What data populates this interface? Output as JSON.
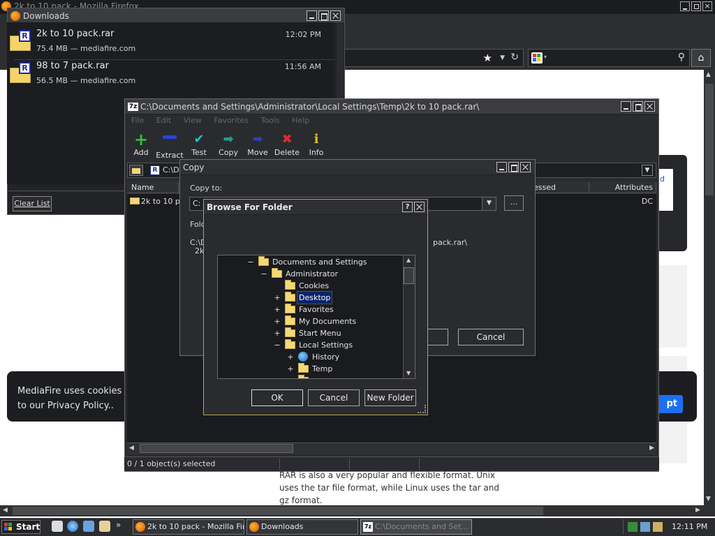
{
  "firefox": {
    "title": "2k to 10 pack - Mozilla Firefox",
    "home_icon": "home-icon"
  },
  "page": {
    "cookie_text": "MediaFire uses cookies to",
    "cookie_text2": "to our Privacy Policy..",
    "cookie_button": "pt",
    "body_text": "RAR is also a very popular and flexible format. Unix uses the tar file format, while Linux uses the tar and gz format.",
    "link_fragment": "d"
  },
  "downloads": {
    "title": "Downloads",
    "items": [
      {
        "name": "2k to 10 pack.rar",
        "meta": "75.4 MB — mediafire.com",
        "time": "12:02 PM"
      },
      {
        "name": "98 to 7 pack.rar",
        "meta": "56.5 MB — mediafire.com",
        "time": "11:56 AM"
      }
    ],
    "clear_label": "Clear List"
  },
  "sevenzip": {
    "title": "C:\\Documents and Settings\\Administrator\\Local Settings\\Temp\\2k to 10 pack.rar\\",
    "app_badge": "7z",
    "menu": [
      "File",
      "Edit",
      "View",
      "Favorites",
      "Tools",
      "Help"
    ],
    "toolbar": [
      {
        "label": "Add",
        "icon": "add-icon",
        "color": "#2fc23a"
      },
      {
        "label": "Extract",
        "icon": "extract-icon",
        "color": "#2545d6"
      },
      {
        "label": "Test",
        "icon": "test-icon",
        "color": "#21c0c9"
      },
      {
        "label": "Copy",
        "icon": "copy-icon",
        "color": "#2a9b8f"
      },
      {
        "label": "Move",
        "icon": "move-icon",
        "color": "#2a3fbf"
      },
      {
        "label": "Delete",
        "icon": "delete-icon",
        "color": "#e12a2a"
      },
      {
        "label": "Info",
        "icon": "info-icon",
        "color": "#e8c21c"
      }
    ],
    "address": "C:\\D",
    "columns": {
      "name": "Name",
      "compressed": "essed",
      "attributes": "Attributes"
    },
    "row": {
      "name": "2k to 10 p",
      "attributes": "DC"
    },
    "status": "0 / 1 object(s) selected"
  },
  "copy_dialog": {
    "title": "Copy",
    "copy_to_label": "Copy to:",
    "combo_value": "C:",
    "browse_label": "...",
    "folder_label": "Fold",
    "path_line1": "C:\\D",
    "path_line2": "2k",
    "path_tail": "pack.rar\\",
    "cancel_label": "Cancel"
  },
  "browse_dialog": {
    "title": "Browse For Folder",
    "help_label": "?",
    "tree": [
      {
        "label": "Documents and Settings",
        "indent": 0,
        "expander": "−"
      },
      {
        "label": "Administrator",
        "indent": 1,
        "expander": "−"
      },
      {
        "label": "Cookies",
        "indent": 2,
        "expander": ""
      },
      {
        "label": "Desktop",
        "indent": 2,
        "expander": "+"
      },
      {
        "label": "Favorites",
        "indent": 2,
        "expander": "+"
      },
      {
        "label": "My Documents",
        "indent": 2,
        "expander": "+"
      },
      {
        "label": "Start Menu",
        "indent": 2,
        "expander": "+"
      },
      {
        "label": "Local Settings",
        "indent": 2,
        "expander": "−"
      },
      {
        "label": "History",
        "indent": 3,
        "expander": "+"
      },
      {
        "label": "Temp",
        "indent": 3,
        "expander": "+"
      }
    ],
    "selected": "Desktop",
    "ok_label": "OK",
    "cancel_label": "Cancel",
    "new_folder_label": "New Folder"
  },
  "taskbar": {
    "start_label": "Start",
    "tasks": [
      {
        "label": "2k to 10 pack - Mozilla Fir..."
      },
      {
        "label": "Downloads"
      },
      {
        "label": "C:\\Documents and Set..."
      }
    ],
    "clock": "12:11 PM",
    "overflow": "»"
  }
}
